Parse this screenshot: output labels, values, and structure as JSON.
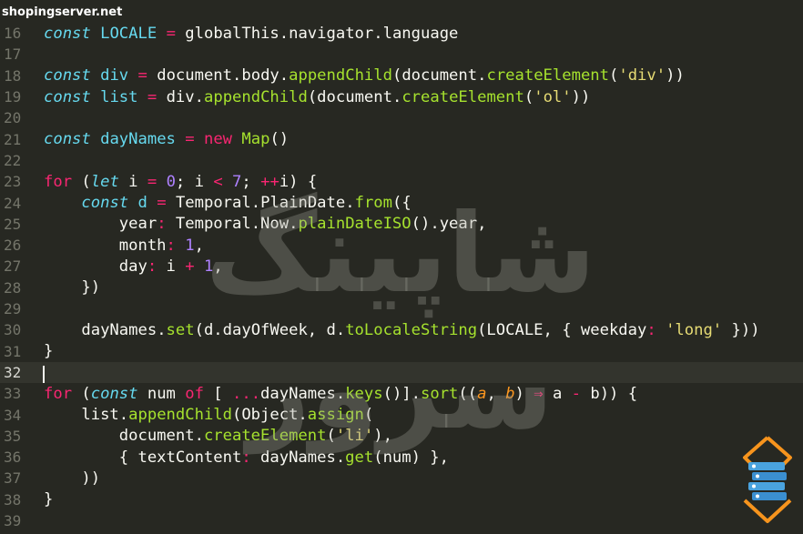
{
  "watermark": {
    "site": "shopingserver.net",
    "brand_text": "شاپینگ سرور"
  },
  "editor": {
    "current_line": "32",
    "lines": [
      {
        "num": "16",
        "tokens": [
          [
            "k",
            "const"
          ],
          [
            "p",
            " "
          ],
          [
            "lv",
            "LOCALE"
          ],
          [
            "p",
            " "
          ],
          [
            "o",
            "="
          ],
          [
            "p",
            " globalThis"
          ],
          [
            "p",
            "."
          ],
          [
            "p",
            "navigator"
          ],
          [
            "p",
            "."
          ],
          [
            "p",
            "language"
          ]
        ]
      },
      {
        "num": "17",
        "tokens": []
      },
      {
        "num": "18",
        "tokens": [
          [
            "k",
            "const"
          ],
          [
            "p",
            " "
          ],
          [
            "lv",
            "div"
          ],
          [
            "p",
            " "
          ],
          [
            "o",
            "="
          ],
          [
            "p",
            " document"
          ],
          [
            "p",
            "."
          ],
          [
            "p",
            "body"
          ],
          [
            "p",
            "."
          ],
          [
            "f",
            "appendChild"
          ],
          [
            "p",
            "(document"
          ],
          [
            "p",
            "."
          ],
          [
            "f",
            "createElement"
          ],
          [
            "p",
            "("
          ],
          [
            "s",
            "'div'"
          ],
          [
            "p",
            "))"
          ]
        ]
      },
      {
        "num": "19",
        "tokens": [
          [
            "k",
            "const"
          ],
          [
            "p",
            " "
          ],
          [
            "lv",
            "list"
          ],
          [
            "p",
            " "
          ],
          [
            "o",
            "="
          ],
          [
            "p",
            " div"
          ],
          [
            "p",
            "."
          ],
          [
            "f",
            "appendChild"
          ],
          [
            "p",
            "(document"
          ],
          [
            "p",
            "."
          ],
          [
            "f",
            "createElement"
          ],
          [
            "p",
            "("
          ],
          [
            "s",
            "'ol'"
          ],
          [
            "p",
            "))"
          ]
        ]
      },
      {
        "num": "20",
        "tokens": []
      },
      {
        "num": "21",
        "tokens": [
          [
            "k",
            "const"
          ],
          [
            "p",
            " "
          ],
          [
            "lv",
            "dayNames"
          ],
          [
            "p",
            " "
          ],
          [
            "o",
            "="
          ],
          [
            "p",
            " "
          ],
          [
            "kw",
            "new"
          ],
          [
            "p",
            " "
          ],
          [
            "f",
            "Map"
          ],
          [
            "p",
            "()"
          ]
        ]
      },
      {
        "num": "22",
        "tokens": []
      },
      {
        "num": "23",
        "tokens": [
          [
            "kw",
            "for"
          ],
          [
            "p",
            " ("
          ],
          [
            "k",
            "let"
          ],
          [
            "p",
            " i "
          ],
          [
            "o",
            "="
          ],
          [
            "p",
            " "
          ],
          [
            "n",
            "0"
          ],
          [
            "p",
            "; i "
          ],
          [
            "o",
            "<"
          ],
          [
            "p",
            " "
          ],
          [
            "n",
            "7"
          ],
          [
            "p",
            "; "
          ],
          [
            "o",
            "++"
          ],
          [
            "p",
            "i) {"
          ]
        ]
      },
      {
        "num": "24",
        "tokens": [
          [
            "p",
            "    "
          ],
          [
            "k",
            "const"
          ],
          [
            "p",
            " "
          ],
          [
            "lv",
            "d"
          ],
          [
            "p",
            " "
          ],
          [
            "o",
            "="
          ],
          [
            "p",
            " Temporal"
          ],
          [
            "p",
            "."
          ],
          [
            "p",
            "PlainDate"
          ],
          [
            "p",
            "."
          ],
          [
            "f",
            "from"
          ],
          [
            "p",
            "({"
          ]
        ]
      },
      {
        "num": "25",
        "tokens": [
          [
            "p",
            "        year"
          ],
          [
            "o",
            ":"
          ],
          [
            "p",
            " Temporal"
          ],
          [
            "p",
            "."
          ],
          [
            "p",
            "Now"
          ],
          [
            "p",
            "."
          ],
          [
            "f",
            "plainDateISO"
          ],
          [
            "p",
            "()"
          ],
          [
            "p",
            "."
          ],
          [
            "p",
            "year,"
          ]
        ]
      },
      {
        "num": "26",
        "tokens": [
          [
            "p",
            "        month"
          ],
          [
            "o",
            ":"
          ],
          [
            "p",
            " "
          ],
          [
            "n",
            "1"
          ],
          [
            "p",
            ","
          ]
        ]
      },
      {
        "num": "27",
        "tokens": [
          [
            "p",
            "        day"
          ],
          [
            "o",
            ":"
          ],
          [
            "p",
            " i "
          ],
          [
            "o",
            "+"
          ],
          [
            "p",
            " "
          ],
          [
            "n",
            "1"
          ],
          [
            "p",
            ","
          ]
        ]
      },
      {
        "num": "28",
        "tokens": [
          [
            "p",
            "    })"
          ]
        ]
      },
      {
        "num": "29",
        "tokens": []
      },
      {
        "num": "30",
        "tokens": [
          [
            "p",
            "    dayNames"
          ],
          [
            "p",
            "."
          ],
          [
            "f",
            "set"
          ],
          [
            "p",
            "(d"
          ],
          [
            "p",
            "."
          ],
          [
            "p",
            "dayOfWeek, d"
          ],
          [
            "p",
            "."
          ],
          [
            "f",
            "toLocaleString"
          ],
          [
            "p",
            "(LOCALE, { weekday"
          ],
          [
            "o",
            ":"
          ],
          [
            "p",
            " "
          ],
          [
            "s",
            "'long'"
          ],
          [
            "p",
            " }))"
          ]
        ]
      },
      {
        "num": "31",
        "tokens": [
          [
            "p",
            "}"
          ]
        ]
      },
      {
        "num": "32",
        "tokens": []
      },
      {
        "num": "33",
        "tokens": [
          [
            "kw",
            "for"
          ],
          [
            "p",
            " ("
          ],
          [
            "k",
            "const"
          ],
          [
            "p",
            " num "
          ],
          [
            "kw",
            "of"
          ],
          [
            "p",
            " [ "
          ],
          [
            "o",
            "..."
          ],
          [
            "p",
            "dayNames"
          ],
          [
            "p",
            "."
          ],
          [
            "f",
            "keys"
          ],
          [
            "p",
            "()]"
          ],
          [
            "p",
            "."
          ],
          [
            "f",
            "sort"
          ],
          [
            "p",
            "(("
          ],
          [
            "par",
            "a"
          ],
          [
            "p",
            ", "
          ],
          [
            "par",
            "b"
          ],
          [
            "p",
            ") "
          ],
          [
            "o",
            "⇒"
          ],
          [
            "p",
            " a "
          ],
          [
            "o",
            "-"
          ],
          [
            "p",
            " b)) {"
          ]
        ]
      },
      {
        "num": "34",
        "tokens": [
          [
            "p",
            "    list"
          ],
          [
            "p",
            "."
          ],
          [
            "f",
            "appendChild"
          ],
          [
            "p",
            "(Object"
          ],
          [
            "p",
            "."
          ],
          [
            "f",
            "assign"
          ],
          [
            "p",
            "("
          ]
        ]
      },
      {
        "num": "35",
        "tokens": [
          [
            "p",
            "        document"
          ],
          [
            "p",
            "."
          ],
          [
            "f",
            "createElement"
          ],
          [
            "p",
            "("
          ],
          [
            "s",
            "'li'"
          ],
          [
            "p",
            "),"
          ]
        ]
      },
      {
        "num": "36",
        "tokens": [
          [
            "p",
            "        { textContent"
          ],
          [
            "o",
            ":"
          ],
          [
            "p",
            " dayNames"
          ],
          [
            "p",
            "."
          ],
          [
            "f",
            "get"
          ],
          [
            "p",
            "(num) },"
          ]
        ]
      },
      {
        "num": "37",
        "tokens": [
          [
            "p",
            "    ))"
          ]
        ]
      },
      {
        "num": "38",
        "tokens": [
          [
            "p",
            "}"
          ]
        ]
      },
      {
        "num": "39",
        "tokens": []
      }
    ]
  }
}
